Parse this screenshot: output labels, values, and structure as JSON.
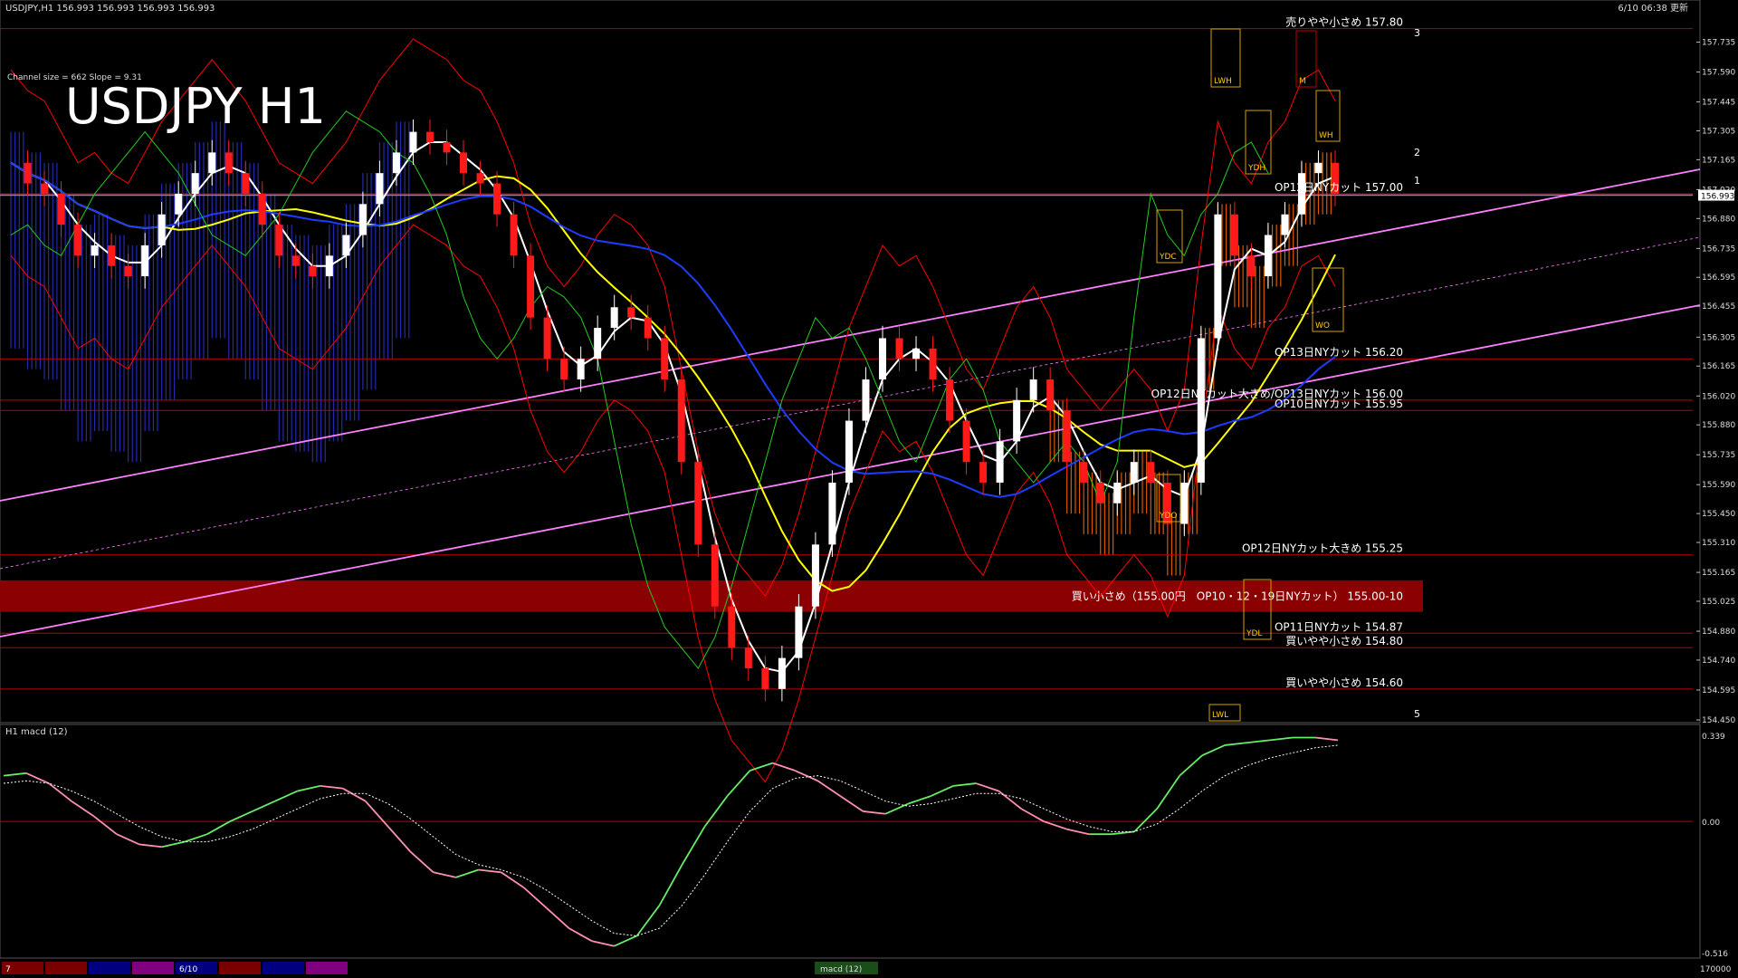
{
  "window": {
    "header": "USDJPY,H1  156.993 156.993 156.993 156.993",
    "clock": "6/10 06:38 更新",
    "channel_info": "Channel size = 662 Slope = 9.31"
  },
  "chart_data": {
    "type": "candlestick",
    "symbol": "USDJPY",
    "timeframe": "H1",
    "title": "USDJPY H1",
    "current_price": 156.993,
    "ylim": [
      154.45,
      157.86
    ],
    "yticks": [
      "157.735",
      "157.590",
      "157.445",
      "157.305",
      "157.165",
      "157.020",
      "156.880",
      "156.735",
      "156.595",
      "156.455",
      "156.305",
      "156.165",
      "156.020",
      "155.880",
      "155.735",
      "155.590",
      "155.450",
      "155.310",
      "155.165",
      "155.025",
      "154.880",
      "154.740",
      "154.595",
      "154.450"
    ],
    "closes": [
      157.15,
      157.05,
      157.0,
      156.85,
      156.7,
      156.75,
      156.65,
      156.6,
      156.75,
      156.9,
      157.0,
      157.1,
      157.2,
      157.1,
      157.0,
      156.85,
      156.7,
      156.65,
      156.6,
      156.7,
      156.8,
      156.95,
      157.1,
      157.2,
      157.3,
      157.25,
      157.2,
      157.1,
      157.05,
      156.9,
      156.7,
      156.4,
      156.2,
      156.1,
      156.2,
      156.35,
      156.45,
      156.4,
      156.3,
      156.1,
      155.7,
      155.3,
      155.0,
      154.8,
      154.7,
      154.6,
      154.75,
      155.0,
      155.3,
      155.6,
      155.9,
      156.1,
      156.3,
      156.2,
      156.25,
      156.1,
      155.9,
      155.7,
      155.6,
      155.8,
      156.0,
      156.1,
      155.95,
      155.7,
      155.6,
      155.5,
      155.6,
      155.7,
      155.6,
      155.4,
      155.6,
      156.3,
      156.9,
      156.7,
      156.6,
      156.8,
      156.9,
      157.1,
      157.15,
      157.0
    ],
    "levels": [
      {
        "price": 157.8,
        "label": "売りやや小さめ 157.80",
        "color": "#c00000"
      },
      {
        "price": 157.0,
        "label": "OP12日NYカット 157.00",
        "color": "#c00000"
      },
      {
        "price": 156.2,
        "label": "OP13日NYカット 156.20",
        "color": "#c00000"
      },
      {
        "price": 156.0,
        "label": "OP12日NYカット大きめ/OP13日NYカット 156.00",
        "color": "#c00000"
      },
      {
        "price": 155.95,
        "label": "OP10日NYカット 155.95",
        "color": "#c00000"
      },
      {
        "price": 155.25,
        "label": "OP12日NYカット大きめ 155.25",
        "color": "#c00000"
      },
      {
        "price": 154.87,
        "label": "OP11日NYカット 154.87",
        "color": "#c00000"
      },
      {
        "price": 154.8,
        "label": "買いやや小さめ 154.80",
        "color": "#c00000"
      },
      {
        "price": 154.6,
        "label": "買いやや小さめ 154.60",
        "color": "#c00000"
      }
    ],
    "zone": {
      "from": 155.0,
      "to": 155.1,
      "label": "買い小さめ（155.00円　OP10・12・19日NYカット） 155.00-10",
      "color": "#8b0000"
    },
    "box_labels": [
      "LWH",
      "YDH",
      "YDC",
      "YDO",
      "YDL",
      "LWL",
      "M",
      "WH",
      "WO"
    ],
    "wave_labels": [
      "1",
      "2",
      "3",
      "5"
    ],
    "colors": {
      "up": "#ffffff",
      "down": "#ff1a1a",
      "cloud_bull": "#2b32c8",
      "cloud_bear": "#ff6a00",
      "ma_fast": "#ffffff",
      "ma_mid": "#ffff00",
      "ma_slow": "#1e3cff",
      "channel": "#ff80ff",
      "bands": "#ff0000",
      "chikou": "#22cc22"
    }
  },
  "macd": {
    "title": "H1  macd (12)",
    "yticks": [
      "0.339",
      "0.00",
      "-0.516"
    ],
    "ylim": [
      -0.516,
      0.339
    ],
    "values": [
      0.18,
      0.19,
      0.15,
      0.08,
      0.02,
      -0.05,
      -0.09,
      -0.1,
      -0.08,
      -0.05,
      0.0,
      0.04,
      0.08,
      0.12,
      0.14,
      0.13,
      0.08,
      -0.02,
      -0.12,
      -0.2,
      -0.22,
      -0.19,
      -0.2,
      -0.26,
      -0.34,
      -0.42,
      -0.47,
      -0.49,
      -0.45,
      -0.33,
      -0.17,
      -0.02,
      0.1,
      0.2,
      0.23,
      0.2,
      0.16,
      0.1,
      0.04,
      0.03,
      0.07,
      0.1,
      0.14,
      0.15,
      0.12,
      0.05,
      0.0,
      -0.03,
      -0.05,
      -0.05,
      -0.04,
      0.05,
      0.18,
      0.26,
      0.3,
      0.31,
      0.32,
      0.33,
      0.33,
      0.32
    ],
    "signal": [
      0.15,
      0.16,
      0.15,
      0.12,
      0.08,
      0.03,
      -0.02,
      -0.06,
      -0.08,
      -0.08,
      -0.06,
      -0.03,
      0.01,
      0.05,
      0.09,
      0.11,
      0.11,
      0.07,
      0.01,
      -0.06,
      -0.13,
      -0.17,
      -0.19,
      -0.22,
      -0.27,
      -0.33,
      -0.39,
      -0.44,
      -0.45,
      -0.42,
      -0.33,
      -0.21,
      -0.08,
      0.04,
      0.13,
      0.17,
      0.18,
      0.16,
      0.12,
      0.08,
      0.06,
      0.07,
      0.09,
      0.11,
      0.11,
      0.09,
      0.05,
      0.01,
      -0.02,
      -0.04,
      -0.04,
      -0.01,
      0.05,
      0.12,
      0.18,
      0.22,
      0.25,
      0.27,
      0.29,
      0.3
    ]
  },
  "bottom_bar": {
    "tabs": [
      {
        "label": "7",
        "color": "#7a0000"
      },
      {
        "label": "",
        "color": "#7a0000"
      },
      {
        "label": "",
        "color": "#000080"
      },
      {
        "label": "",
        "color": "#800080"
      },
      {
        "label": "6/10",
        "color": "#000080"
      },
      {
        "label": "",
        "color": "#7a0000"
      },
      {
        "label": "",
        "color": "#000080"
      },
      {
        "label": "",
        "color": "#800080"
      }
    ],
    "status_label": "macd (12)",
    "right_label": "170000"
  }
}
